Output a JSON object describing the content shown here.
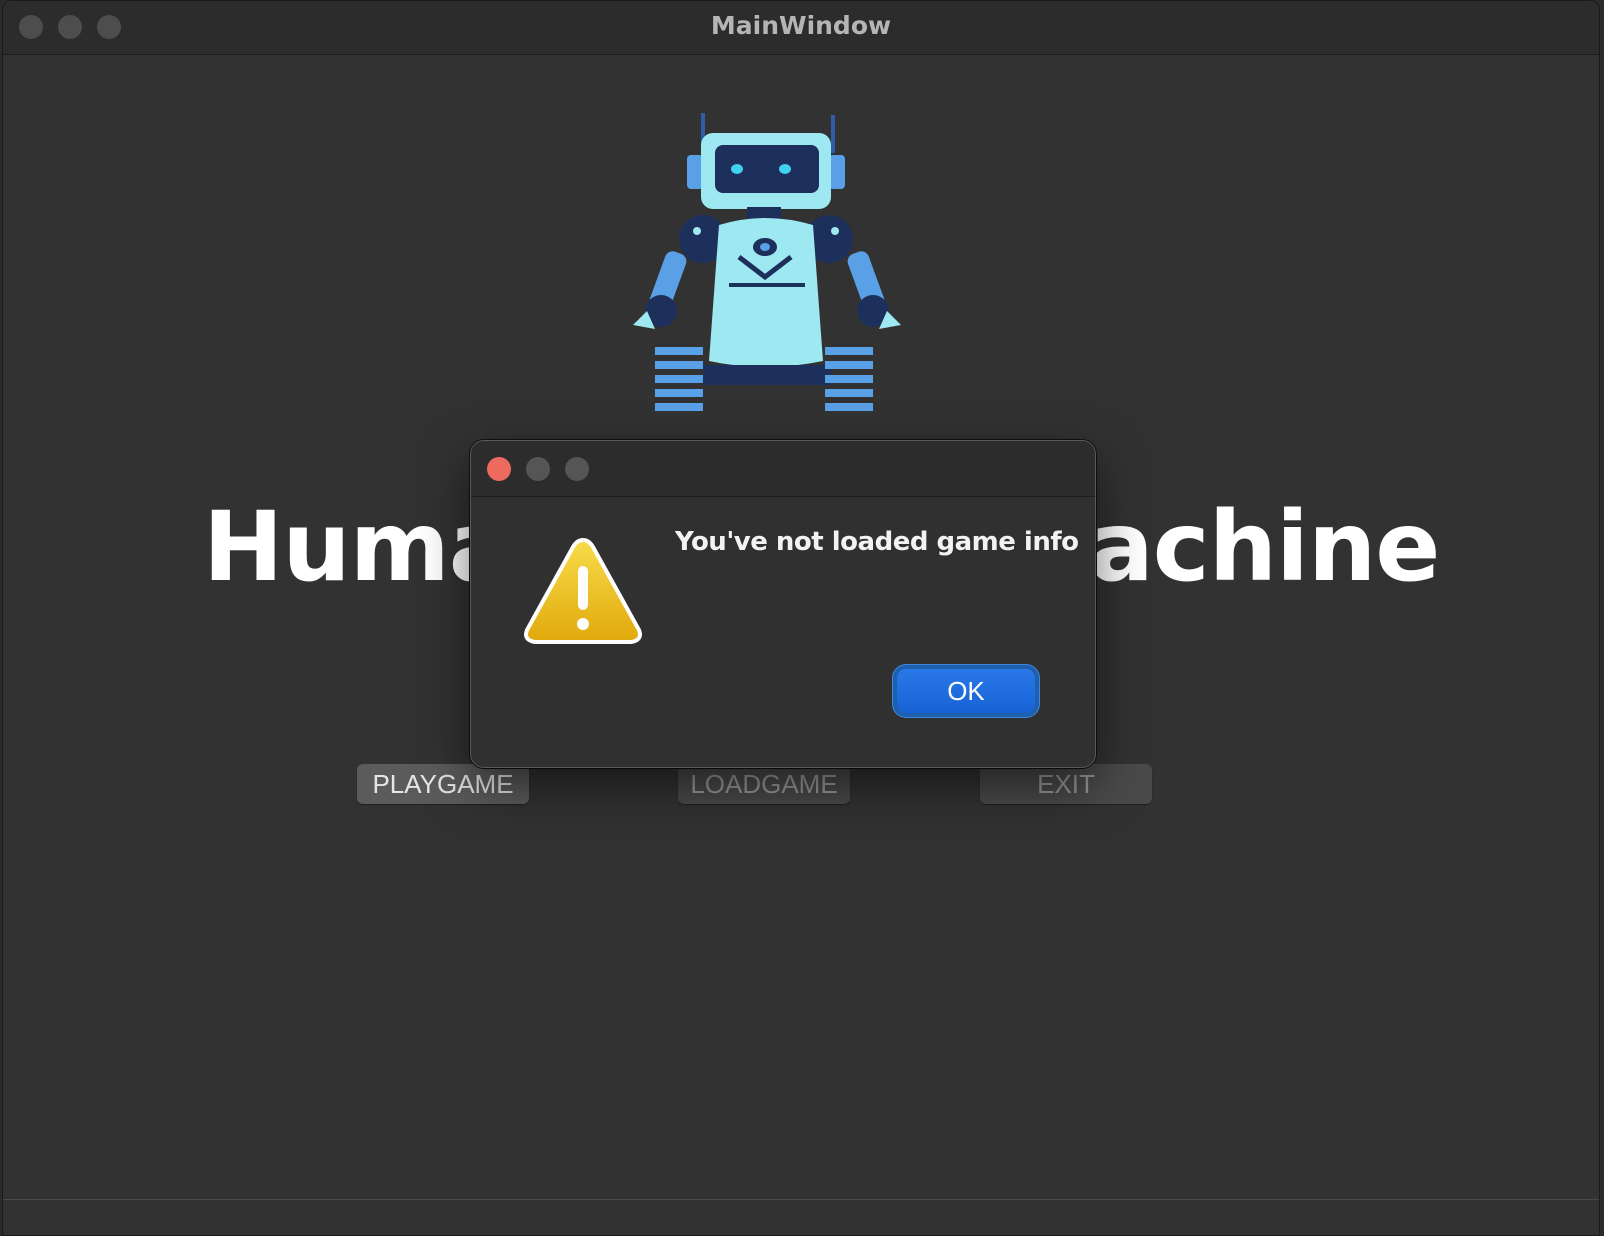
{
  "window": {
    "title": "MainWindow"
  },
  "main": {
    "heading_left": "Huma",
    "heading_right": "achine",
    "buttons": {
      "play": "PLAYGAME",
      "load": "LOADGAME",
      "exit": "EXIT"
    },
    "robot_icon": "robot-illustration"
  },
  "dialog": {
    "message": "You've not loaded game info",
    "ok_label": "OK",
    "icon": "warning-icon"
  },
  "colors": {
    "window_bg": "#323232",
    "accent": "#1763d6",
    "close_red": "#ec6a5e",
    "warning_yellow": "#f2c019"
  }
}
